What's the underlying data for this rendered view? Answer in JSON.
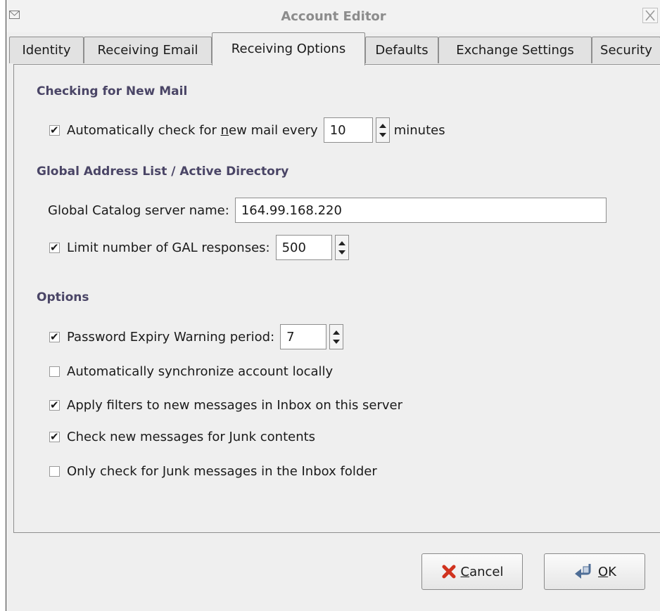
{
  "window": {
    "title": "Account Editor"
  },
  "tabs": [
    {
      "label": "Identity",
      "active": false
    },
    {
      "label": "Receiving Email",
      "active": false
    },
    {
      "label": "Receiving Options",
      "active": true
    },
    {
      "label": "Defaults",
      "active": false
    },
    {
      "label": "Exchange Settings",
      "active": false
    },
    {
      "label": "Security",
      "active": false
    }
  ],
  "checking": {
    "heading": "Checking for New Mail",
    "auto_check": {
      "checked": true,
      "label_before": "Automatically check for ",
      "label_mnemonic": "n",
      "label_after": "ew mail every",
      "value": "10",
      "unit": "minutes"
    }
  },
  "gal": {
    "heading": "Global Address List / Active Directory",
    "catalog_label": "Global Catalog server name:",
    "catalog_value": "164.99.168.220",
    "limit": {
      "checked": true,
      "label": "Limit number of GAL responses:",
      "value": "500"
    }
  },
  "options": {
    "heading": "Options",
    "password_expiry": {
      "checked": true,
      "label": "Password Expiry Warning period:",
      "value": "7"
    },
    "items": [
      {
        "checked": false,
        "label": "Automatically synchronize account locally"
      },
      {
        "checked": true,
        "label": "Apply filters to new messages in Inbox on this server"
      },
      {
        "checked": true,
        "label": "Check new messages for Junk contents"
      },
      {
        "checked": false,
        "label": "Only check for Junk messages in the Inbox folder"
      }
    ]
  },
  "buttons": {
    "cancel_mnemonic": "C",
    "cancel_rest": "ancel",
    "ok_mnemonic": "O",
    "ok_rest": "K"
  },
  "colors": {
    "heading": "#4a4566",
    "cancel_icon": "#d0321e",
    "ok_icon": "#4e6d96"
  }
}
